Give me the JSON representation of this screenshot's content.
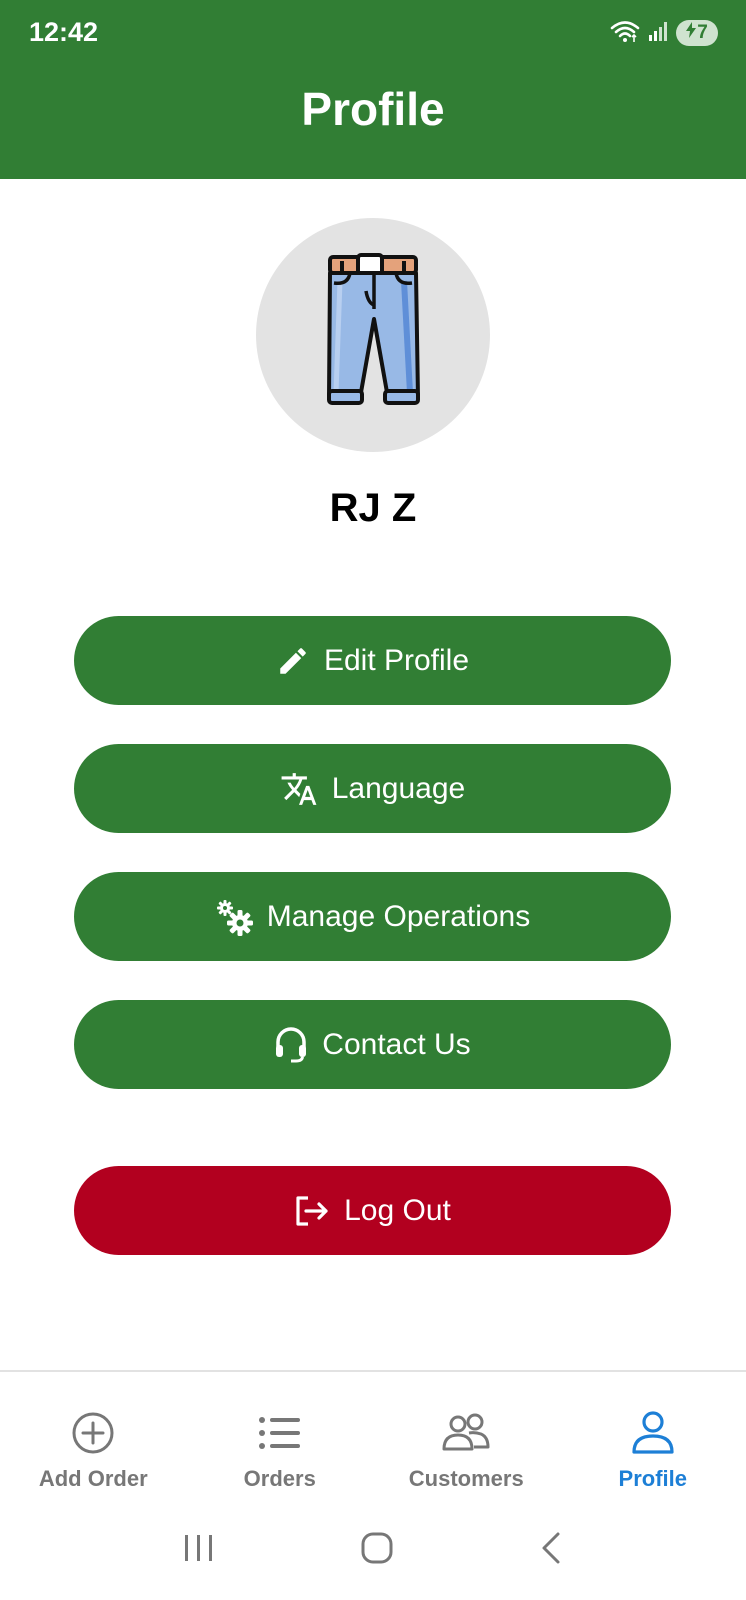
{
  "status_bar": {
    "time": "12:42",
    "battery_level": "7"
  },
  "header": {
    "title": "Profile"
  },
  "profile": {
    "avatar_icon": "jeans-icon",
    "name": "RJ Z"
  },
  "actions": {
    "edit_profile": "Edit Profile",
    "language": "Language",
    "manage_operations": "Manage Operations",
    "contact_us": "Contact Us",
    "log_out": "Log Out"
  },
  "bottom_nav": {
    "items": [
      {
        "label": "Add Order",
        "icon": "add-circle-icon"
      },
      {
        "label": "Orders",
        "icon": "list-icon"
      },
      {
        "label": "Customers",
        "icon": "people-icon"
      },
      {
        "label": "Profile",
        "icon": "person-icon",
        "active": true
      }
    ]
  },
  "colors": {
    "primary_green": "#317e34",
    "logout_red": "#b2001f",
    "active_blue": "#1d7fd6",
    "inactive_gray": "#777777"
  }
}
